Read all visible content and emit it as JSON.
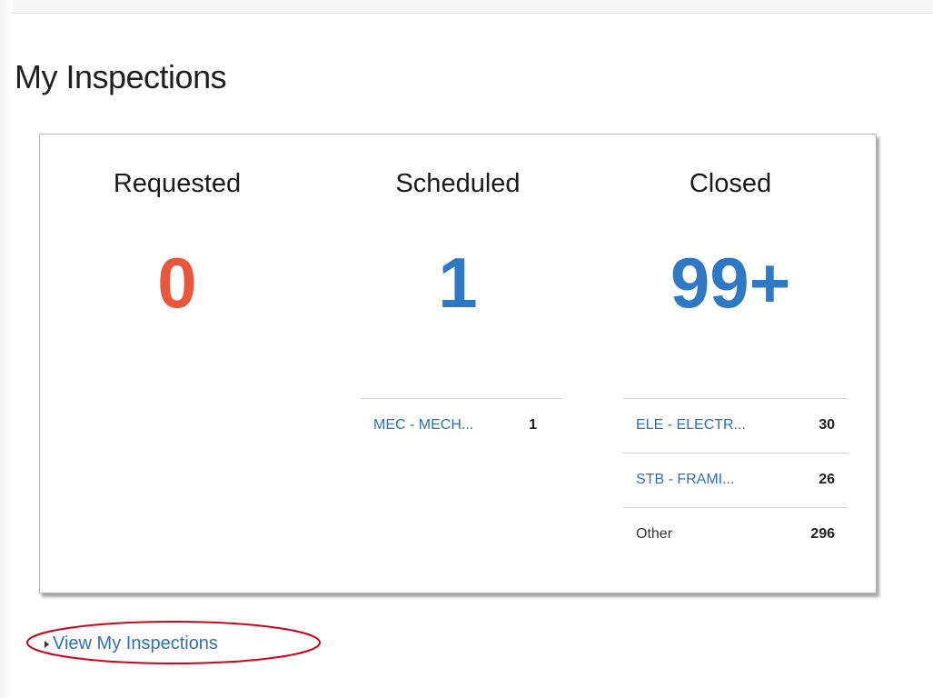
{
  "page": {
    "title": "My Inspections"
  },
  "colors": {
    "requested": "#e8563d",
    "count_blue": "#2f78c4",
    "link": "#2f6fb8",
    "annotation": "#d0021b"
  },
  "columns": {
    "requested": {
      "heading": "Requested",
      "count": "0",
      "rows": []
    },
    "scheduled": {
      "heading": "Scheduled",
      "count": "1",
      "rows": [
        {
          "label": "MEC - MECH...",
          "count": "1"
        }
      ]
    },
    "closed": {
      "heading": "Closed",
      "count": "99+",
      "rows": [
        {
          "label": "ELE - ELECTR...",
          "count": "30"
        },
        {
          "label": "STB - FRAMI...",
          "count": "26"
        },
        {
          "label": "Other",
          "count": "296"
        }
      ]
    }
  },
  "footer": {
    "view_link_label": "View My Inspections",
    "caret_icon": "caret-right-icon"
  }
}
